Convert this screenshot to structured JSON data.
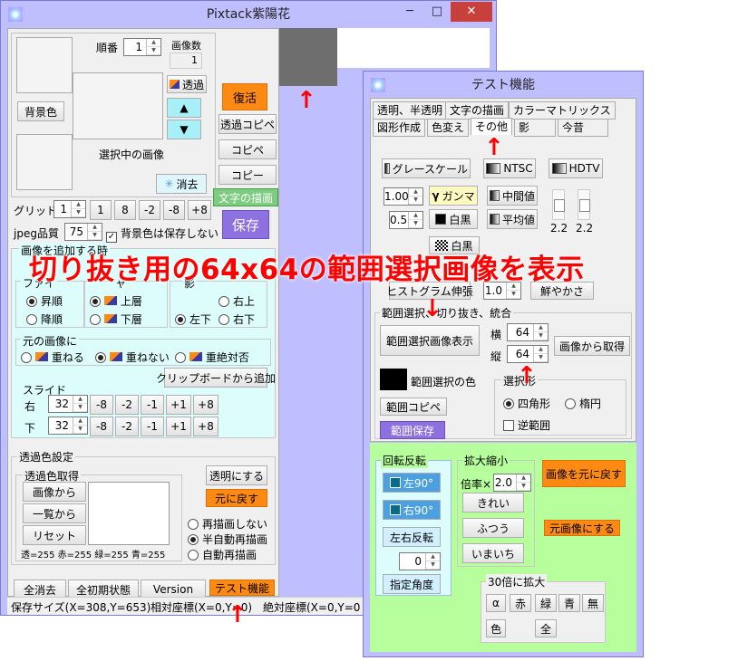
{
  "main": {
    "title": "Pixtack紫陽花",
    "order_label": "順番",
    "order_value": "1",
    "image_count_label": "画像数",
    "image_count_value": "1",
    "bg_color_btn": "背景色",
    "transparent_btn": "透過",
    "selected_image_label": "選択中の画像",
    "erase_btn": "消去",
    "restore_btn": "復活",
    "transparent_copy_btn": "透過コピペ",
    "copy_paste_btn": "コピペ",
    "copy_btn": "コピー",
    "text_draw_btn": "文字の描画",
    "save_btn": "保存",
    "grid_label": "グリッド",
    "grid_value": "1",
    "grid_steps": [
      "1",
      "8",
      "-2",
      "-8",
      "+8"
    ],
    "jpeg_label": "jpeg品質",
    "jpeg_value": "75",
    "bg_nosave_label": "背景色は保存しない",
    "add_image_label": "画像を追加する時",
    "file_label": "ファイ",
    "asc_label": "昇順",
    "desc_label": "降順",
    "layer_label": "ャ",
    "top_layer_label": "上層",
    "bottom_layer_label": "下層",
    "shadow_label": "影",
    "upper_right_label": "右上",
    "lower_left_label": "左下",
    "lower_right_label": "右下",
    "original_label": "元の画像に",
    "overlap_label": "重ねる",
    "no_overlap_label": "重ねない",
    "absolute_label": "重絶対否",
    "clipboard_add_btn": "クリップボードから追加",
    "slide_label": "スライド",
    "right_label": "右",
    "down_label": "下",
    "slide_right_value": "32",
    "slide_down_value": "32",
    "slide_steps": [
      "-8",
      "-2",
      "-1",
      "+1",
      "+8"
    ],
    "transp_setting_label": "透過色設定",
    "transp_get_label": "透過色取得",
    "from_image_btn": "画像から",
    "from_list_btn": "一覧から",
    "reset_btn": "リセット",
    "make_transparent_btn": "透明にする",
    "revert_btn": "元に戻す",
    "no_redraw_label": "再描画しない",
    "semi_auto_label": "半自動再描画",
    "auto_redraw_label": "自動再描画",
    "rgba_readout": "透=255 赤=255 緑=255 青=255",
    "clear_all_btn": "全消去",
    "init_btn": "全初期状態",
    "version_btn": "Version",
    "test_btn": "テスト機能",
    "status_save_size": "保存サイズ(X=308,Y=653)",
    "status_relative": "相対座標(X=0,Y=0)",
    "status_absolute": "絶対座標(X=0,Y=0"
  },
  "test": {
    "title": "テスト機能",
    "tabs_row1": [
      "透明、半透明",
      "文字の描画",
      "カラーマトリックス"
    ],
    "tabs_row2": [
      "図形作成",
      "色変え",
      "その他",
      "影",
      "今昔"
    ],
    "grayscale_btn": "グレースケール",
    "ntsc_btn": "NTSC",
    "hdtv_btn": "HDTV",
    "gamma_value": "1.00",
    "gamma_btn": "ガンマ",
    "midvalue_btn": "中間値",
    "bw_value": "0.5",
    "bw_btn": "白黒",
    "average_btn": "平均値",
    "slider_value_1": "2.2",
    "slider_value_2": "2.2",
    "bw2_btn": "白黒",
    "hist_btn": "ヒストグラム伸張",
    "hist_value": "1.0",
    "sharpen_btn": "鮮やかさ",
    "range_group_label": "範囲選択、切り抜き、統合",
    "show_range_btn": "範囲選択画像表示",
    "width_label": "横",
    "height_label": "縦",
    "width_value": "64",
    "height_value": "64",
    "get_from_image_btn": "画像から取得",
    "range_color_label": "範囲選択の色",
    "range_copy_btn": "範囲コピペ",
    "range_save_btn": "範囲保存",
    "select_shape_label": "選択形",
    "rect_label": "四角形",
    "ellipse_label": "楕円",
    "inverse_label": "逆範囲",
    "rotate_label": "回転反転",
    "rot_left_btn": "左90°",
    "rot_right_btn": "右90°",
    "flip_btn": "左右反転",
    "angle_value": "0",
    "angle_btn": "指定角度",
    "scale_label": "拡大縮小",
    "ratio_label": "倍率×",
    "ratio_value": "2.0",
    "pretty_btn": "きれい",
    "normal_btn": "ふつう",
    "imaichi_btn": "いまいち",
    "restore_image_btn": "画像を元に戻す",
    "set_original_btn": "元画像にする",
    "zoom30_label": "30倍に拡大",
    "zoom_btns": [
      "α",
      "赤",
      "緑",
      "青",
      "無"
    ],
    "color_btn": "色",
    "all_btn": "全"
  },
  "annotation": "切り抜き用の64x64の範囲選択画像を表示",
  "colors": {
    "window_border": "#bfbfff",
    "orange_button": "#fe8a14",
    "green_button": "#7ccd80",
    "purple_button": "#8e71e0",
    "cyan_group": "#dcfdfb",
    "green_panel": "#b6ff9c",
    "annotation": "#ff0000",
    "close_button": "#c7403b"
  },
  "icons": [
    "app-icon",
    "minimize-icon",
    "maximize-icon",
    "close-icon",
    "sparkle-icon",
    "layer-icon",
    "gradient-icon",
    "gamma-icon",
    "checker-icon",
    "rotate-left-icon",
    "rotate-right-icon",
    "red-arrow-icon"
  ]
}
